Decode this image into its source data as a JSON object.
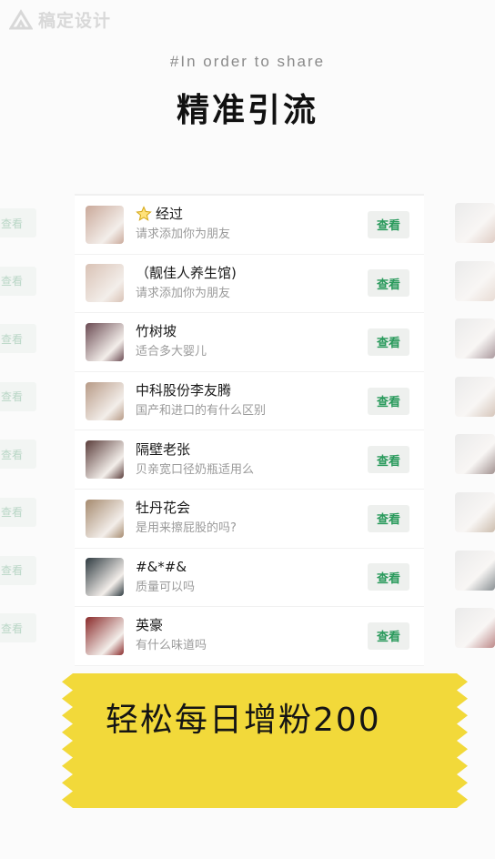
{
  "watermark": {
    "text": "稿定设计"
  },
  "header": {
    "subtitle": "#In order to share",
    "title": "精准引流"
  },
  "list": {
    "button_label": "查看",
    "items": [
      {
        "name": "经过",
        "message": "请求添加你为朋友",
        "starred": true,
        "avatar_color": "#caa99a"
      },
      {
        "name": "（靓佳人养生馆)",
        "message": "请求添加你为朋友",
        "starred": false,
        "avatar_color": "#d9c2b5"
      },
      {
        "name": "竹树坡",
        "message": "适合多大婴儿",
        "starred": false,
        "avatar_color": "#6a4a52"
      },
      {
        "name": "中科股份李友腾",
        "message": "国产和进口的有什么区别",
        "starred": false,
        "avatar_color": "#b79a86"
      },
      {
        "name": "隔壁老张",
        "message": "贝亲宽口径奶瓶适用么",
        "starred": false,
        "avatar_color": "#5a3d3a"
      },
      {
        "name": "牡丹花会",
        "message": "是用来擦屁股的吗?",
        "starred": false,
        "avatar_color": "#a58a6e"
      },
      {
        "name": "#&*#&",
        "message": "质量可以吗",
        "starred": false,
        "avatar_color": "#2e3a40"
      },
      {
        "name": "英豪",
        "message": "有什么味道吗",
        "starred": false,
        "avatar_color": "#8a2a2a"
      }
    ]
  },
  "banner": {
    "text": "轻松每日增粉200",
    "color": "#f2d93a"
  },
  "colors": {
    "button_text": "#2a9a5c",
    "button_bg": "#eef0ee"
  }
}
